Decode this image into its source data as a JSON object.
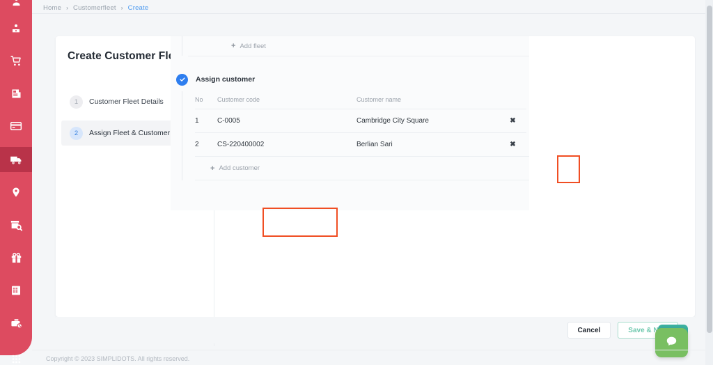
{
  "breadcrumb": {
    "items": [
      {
        "label": "Home",
        "current": false
      },
      {
        "label": "Customerfleet",
        "current": false
      },
      {
        "label": "Create",
        "current": true
      }
    ],
    "separator": "›"
  },
  "sidebar": {
    "background_color": "#dd4b60",
    "active_background_color": "#b93349",
    "items": [
      {
        "icon": "user-profile-icon",
        "active": false
      },
      {
        "icon": "shopping-cart-icon",
        "active": false
      },
      {
        "icon": "invoice-document-icon",
        "active": false
      },
      {
        "icon": "credit-card-icon",
        "active": false
      },
      {
        "icon": "delivery-truck-icon",
        "active": true
      },
      {
        "icon": "map-pin-icon",
        "active": false
      },
      {
        "icon": "store-search-icon",
        "active": false
      },
      {
        "icon": "gift-box-icon",
        "active": false
      },
      {
        "icon": "spreadsheet-grid-icon",
        "active": false
      },
      {
        "icon": "briefcase-clock-icon",
        "active": false
      },
      {
        "icon": "apps-grid-icon",
        "active": false
      }
    ]
  },
  "page": {
    "title": "Create Customer Fleet"
  },
  "stepper": {
    "steps": [
      {
        "number": "1",
        "label": "Customer Fleet Details",
        "active": false
      },
      {
        "number": "2",
        "label": "Assign Fleet & Customer",
        "active": true
      }
    ]
  },
  "panel": {
    "add_fleet": {
      "label": "Add fleet",
      "plus": "+"
    },
    "assign_customer": {
      "title": "Assign customer",
      "status_icon": "check-circle-icon",
      "status_color": "#2e7eef"
    },
    "table": {
      "columns": [
        "No",
        "Customer code",
        "Customer name",
        ""
      ],
      "rows": [
        {
          "no": "1",
          "customer_code": "C-0005",
          "customer_name": "Cambridge City Square",
          "delete_icon": "✖"
        },
        {
          "no": "2",
          "customer_code": "CS-220400002",
          "customer_name": "Berlian Sari",
          "delete_icon": "✖"
        }
      ]
    },
    "add_customer": {
      "label": "Add customer",
      "plus": "+"
    }
  },
  "highlights": {
    "color": "#f04e23",
    "regions": [
      {
        "name": "delete-row-1",
        "description": "delete button of row 1"
      },
      {
        "name": "add-customer",
        "description": "Add customer link"
      }
    ]
  },
  "actions": {
    "cancel_label": "Cancel",
    "save_new_label": "Save & New",
    "save_new_color": "#6fc8ae"
  },
  "chat_widget": {
    "icon": "chat-bubble-icon",
    "button_color": "#79bf62",
    "backdrop_color": "#3cb0a0"
  },
  "footer": {
    "copyright": "Copyright © 2023 SIMPLIDOTS. All rights reserved."
  }
}
